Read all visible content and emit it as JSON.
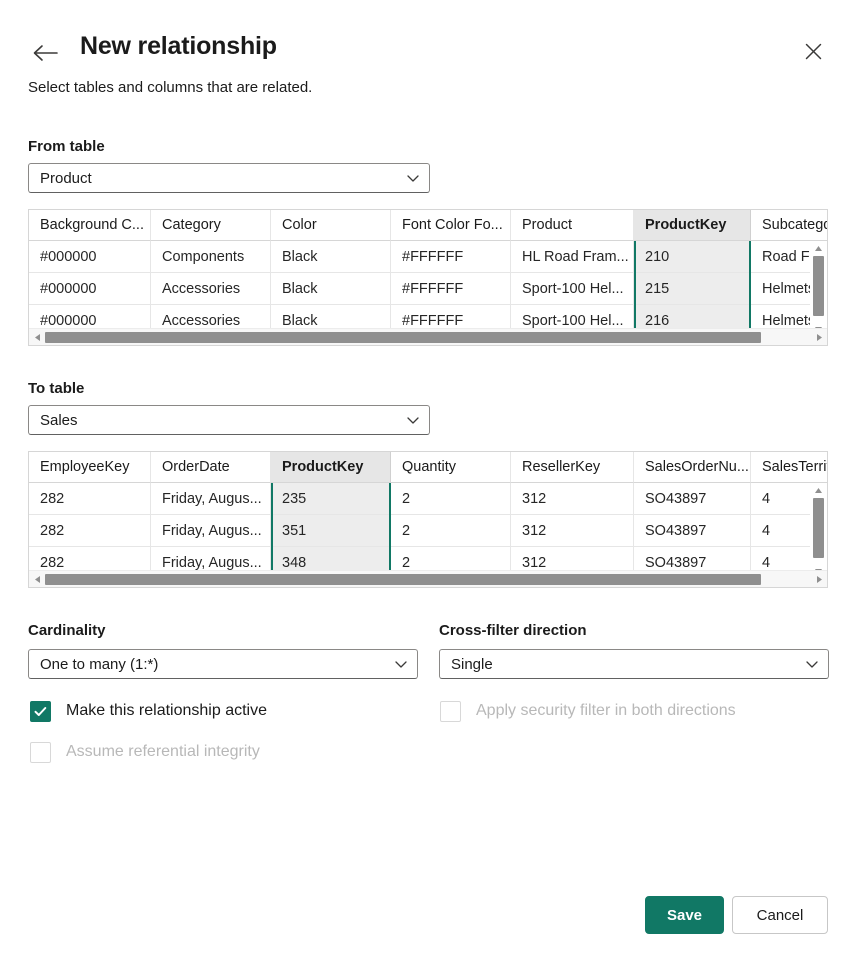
{
  "dialog": {
    "title": "New relationship",
    "subtitle": "Select tables and columns that are related.",
    "back_icon": "arrow-left-icon",
    "close_icon": "close-icon",
    "accent_color": "#117865"
  },
  "from_table": {
    "label": "From table",
    "selected": "Product",
    "chevron_icon": "chevron-down-icon",
    "selected_column": "ProductKey",
    "columns": [
      "Background C...",
      "Category",
      "Color",
      "Font Color Fo...",
      "Product",
      "ProductKey",
      "Subcategd"
    ],
    "rows": [
      [
        "#000000",
        "Components",
        "Black",
        "#FFFFFF",
        "HL Road Fram...",
        "210",
        "Road Fra"
      ],
      [
        "#000000",
        "Accessories",
        "Black",
        "#FFFFFF",
        "Sport-100 Hel...",
        "215",
        "Helmets"
      ],
      [
        "#000000",
        "Accessories",
        "Black",
        "#FFFFFF",
        "Sport-100 Hel...",
        "216",
        "Helmets"
      ]
    ]
  },
  "to_table": {
    "label": "To table",
    "selected": "Sales",
    "chevron_icon": "chevron-down-icon",
    "selected_column": "ProductKey",
    "columns": [
      "EmployeeKey",
      "OrderDate",
      "ProductKey",
      "Quantity",
      "ResellerKey",
      "SalesOrderNu...",
      "SalesTerrit"
    ],
    "rows": [
      [
        "282",
        "Friday, Augus...",
        "235",
        "2",
        "312",
        "SO43897",
        "4"
      ],
      [
        "282",
        "Friday, Augus...",
        "351",
        "2",
        "312",
        "SO43897",
        "4"
      ],
      [
        "282",
        "Friday, Augus...",
        "348",
        "2",
        "312",
        "SO43897",
        "4"
      ]
    ]
  },
  "cardinality": {
    "label": "Cardinality",
    "selected": "One to many (1:*)",
    "chevron_icon": "chevron-down-icon"
  },
  "cross_filter": {
    "label": "Cross-filter direction",
    "selected": "Single",
    "chevron_icon": "chevron-down-icon"
  },
  "options": {
    "make_active": {
      "label": "Make this relationship active",
      "checked": true,
      "disabled": false
    },
    "assume_referential_integrity": {
      "label": "Assume referential integrity",
      "checked": false,
      "disabled": true
    },
    "apply_security_filter": {
      "label": "Apply security filter in both directions",
      "checked": false,
      "disabled": true
    }
  },
  "footer": {
    "save_label": "Save",
    "cancel_label": "Cancel"
  }
}
